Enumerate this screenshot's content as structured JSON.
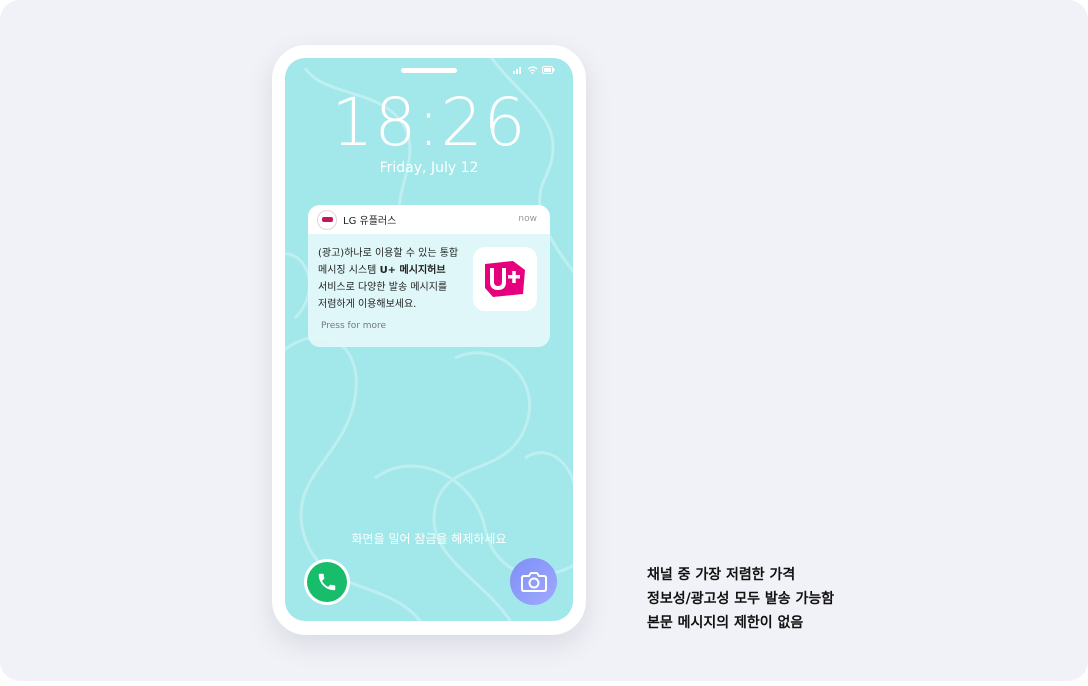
{
  "lockscreen": {
    "time": "18:26",
    "date": "Friday, July 12",
    "unlock_hint": "화면을 밀어 잠금을 해제하세요"
  },
  "notification": {
    "app_name": "LG 유플러스",
    "time": "now",
    "message_line1": "(광고)하나로 이용할 수 있는 통합",
    "message_line2_prefix": "메시징 시스템 ",
    "message_line2_bold": "U+ 메시지허브",
    "message_line3": "서비스로 다양한 발송 메시지를",
    "message_line4": "저렴하게 이용해보세요.",
    "press_hint": "Press for more",
    "thumbnail_logo": "U+"
  },
  "features": [
    "채널 중 가장 저렴한 가격",
    "정보성/광고성 모두 발송 가능함",
    "본문 메시지의 제한이 없음"
  ],
  "icons": {
    "call": "phone-icon",
    "camera": "camera-icon"
  },
  "colors": {
    "screen_bg": "#a2e7ea",
    "brand_magenta": "#e6007e",
    "call_green": "#17bd6b",
    "camera_purple": "#8b98f8"
  }
}
